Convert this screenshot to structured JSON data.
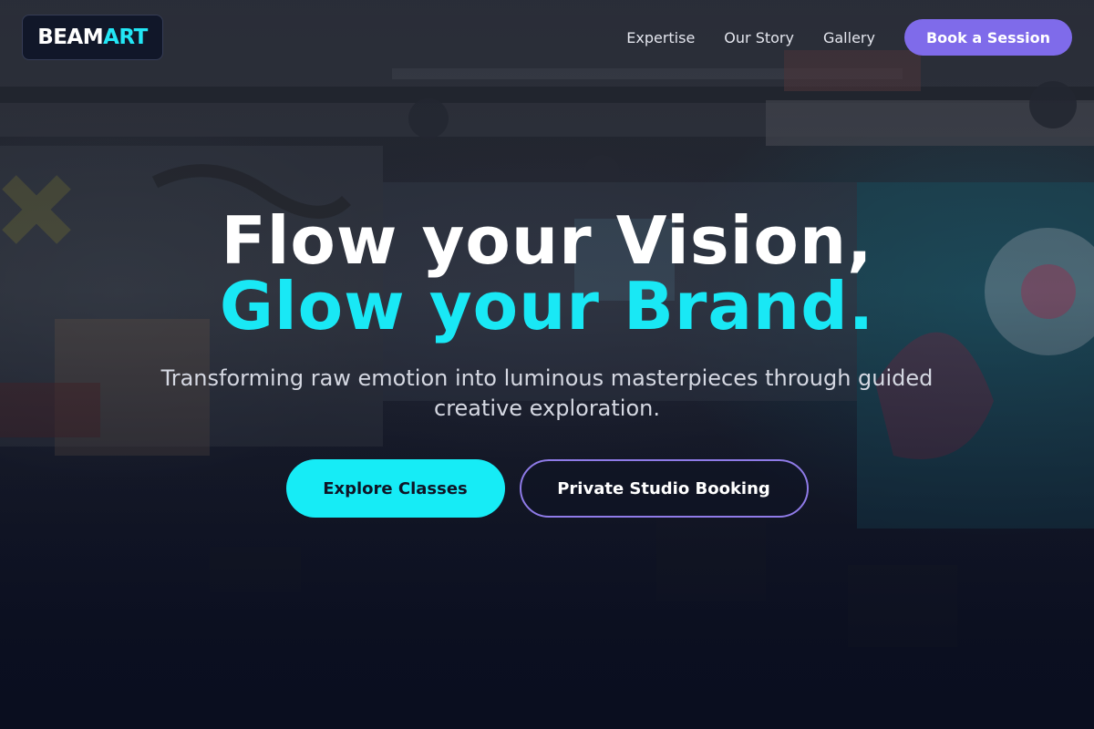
{
  "brand": {
    "part1": "BEAM",
    "part2": "ART"
  },
  "nav": {
    "items": [
      {
        "label": "Expertise"
      },
      {
        "label": "Our Story"
      },
      {
        "label": "Gallery"
      }
    ],
    "cta_label": "Book a Session"
  },
  "hero": {
    "headline_line1": "Flow your Vision,",
    "headline_line2": "Glow your Brand.",
    "subtitle": "Transforming raw emotion into luminous masterpieces through guided creative exploration.",
    "primary_button": "Explore Classes",
    "secondary_button": "Private Studio Booking"
  },
  "colors": {
    "accent_cyan": "#19e8f5",
    "accent_purple": "#7f6bea",
    "background": "#0a0e1f"
  }
}
